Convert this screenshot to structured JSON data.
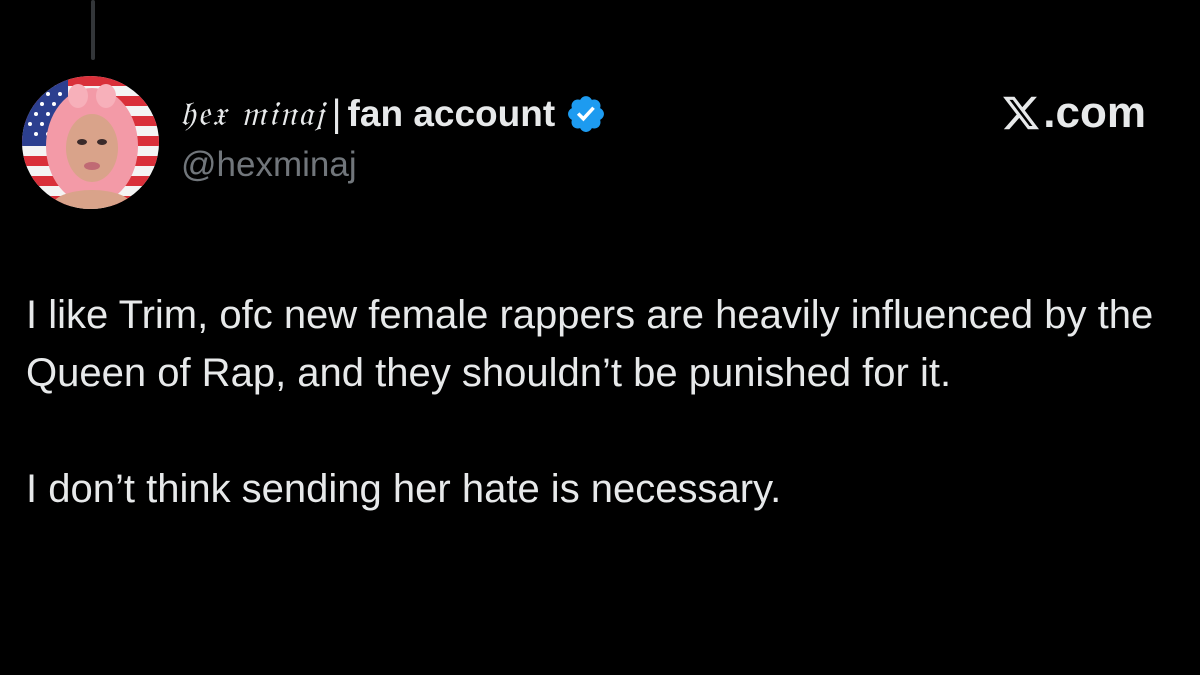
{
  "tweet": {
    "display_name_stylized": "𝔥𝔢𝔵 𝔪𝔦𝔫𝔞𝔧",
    "display_name_separator": "|",
    "display_name_suffix": "fan account",
    "handle": "@hexminaj",
    "verified": true,
    "verified_icon": "verified-badge-icon",
    "brand_text": ".com",
    "brand_icon": "x-logo-icon",
    "body_paragraphs": [
      "I like Trim, ofc new female rappers are heavily influenced by the Queen of Rap, and they shouldn’t be punished for it.",
      "I don’t think sending her hate is necessary."
    ]
  },
  "colors": {
    "background": "#000000",
    "text_primary": "#e7e9ea",
    "text_secondary": "#71767b",
    "verified_blue": "#1d9bf0",
    "thread_line": "#333639"
  }
}
